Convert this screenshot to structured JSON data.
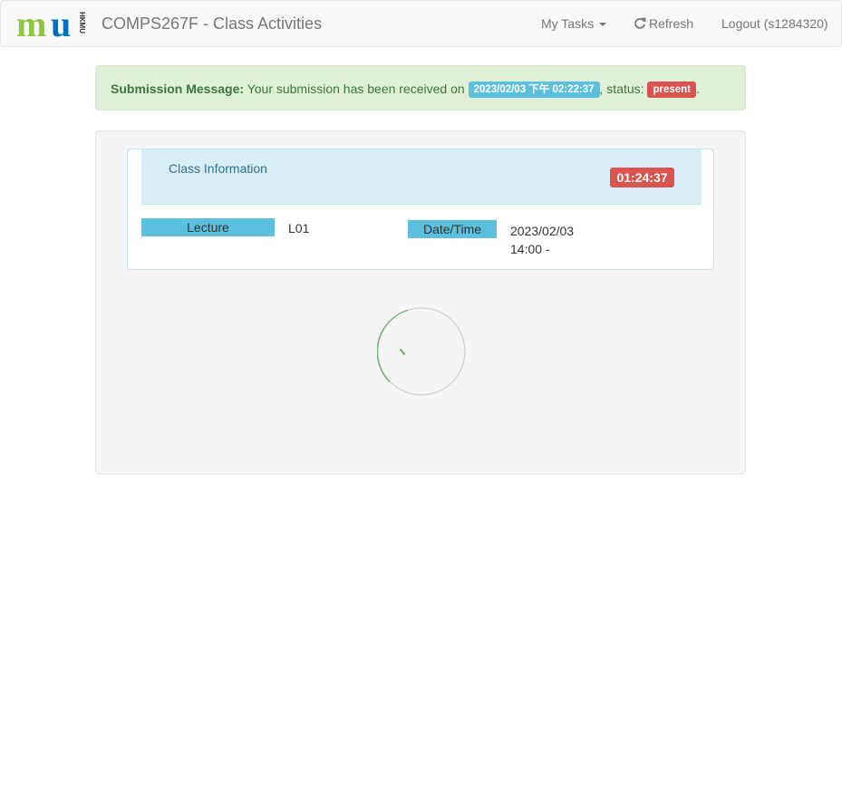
{
  "navbar": {
    "logo_text": "mu",
    "logo_side_text": "HKMU",
    "brand": "COMPS267F - Class Activities",
    "tasks_label": "My Tasks",
    "refresh_label": "Refresh",
    "logout_label": "Logout (s1284320)"
  },
  "alert": {
    "heading": "Submission Message:",
    "text": "Your submission has been received on",
    "timestamp": "2023/02/03 下午 02:22:37",
    "status_prefix": ", status:",
    "status": "present",
    "end": "."
  },
  "class_info": {
    "title": "Class Information",
    "timer": "01:24:37",
    "lecture_label": "Lecture",
    "lecture_value": "L01",
    "datetime_label": "Date/Time",
    "date": "2023/02/03",
    "time": "14:00 -"
  },
  "colors": {
    "success_bg": "#dff0d8",
    "info": "#5bc0de",
    "danger": "#d9534f",
    "spinner": "#5cb85c"
  }
}
